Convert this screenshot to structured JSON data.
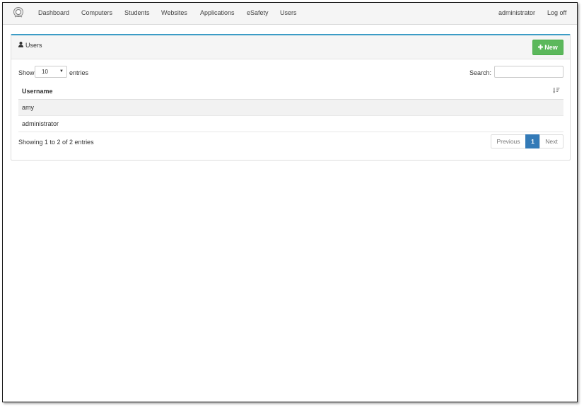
{
  "navbar": {
    "items": [
      "Dashboard",
      "Computers",
      "Students",
      "Websites",
      "Applications",
      "eSafety",
      "Users"
    ],
    "user": "administrator",
    "logoff": "Log off"
  },
  "panel": {
    "title": "Users",
    "new_button": "New",
    "accent": "#3c9cc6",
    "new_color": "#5cb85c"
  },
  "controls": {
    "show_label": "Show",
    "page_size": "10",
    "entries_label": "entries",
    "search_label": "Search:",
    "search_value": ""
  },
  "table": {
    "columns": [
      "Username"
    ],
    "rows": [
      [
        "amy"
      ],
      [
        "administrator"
      ]
    ]
  },
  "footer": {
    "info": "Showing 1 to 2 of 2 entries",
    "previous": "Previous",
    "current_page": "1",
    "next": "Next",
    "page_color": "#337ab7"
  },
  "icons": {
    "logo": "logo-icon",
    "user": "user-icon",
    "plus": "plus-icon",
    "caret": "caret-down-icon",
    "sort": "sort-icon"
  }
}
